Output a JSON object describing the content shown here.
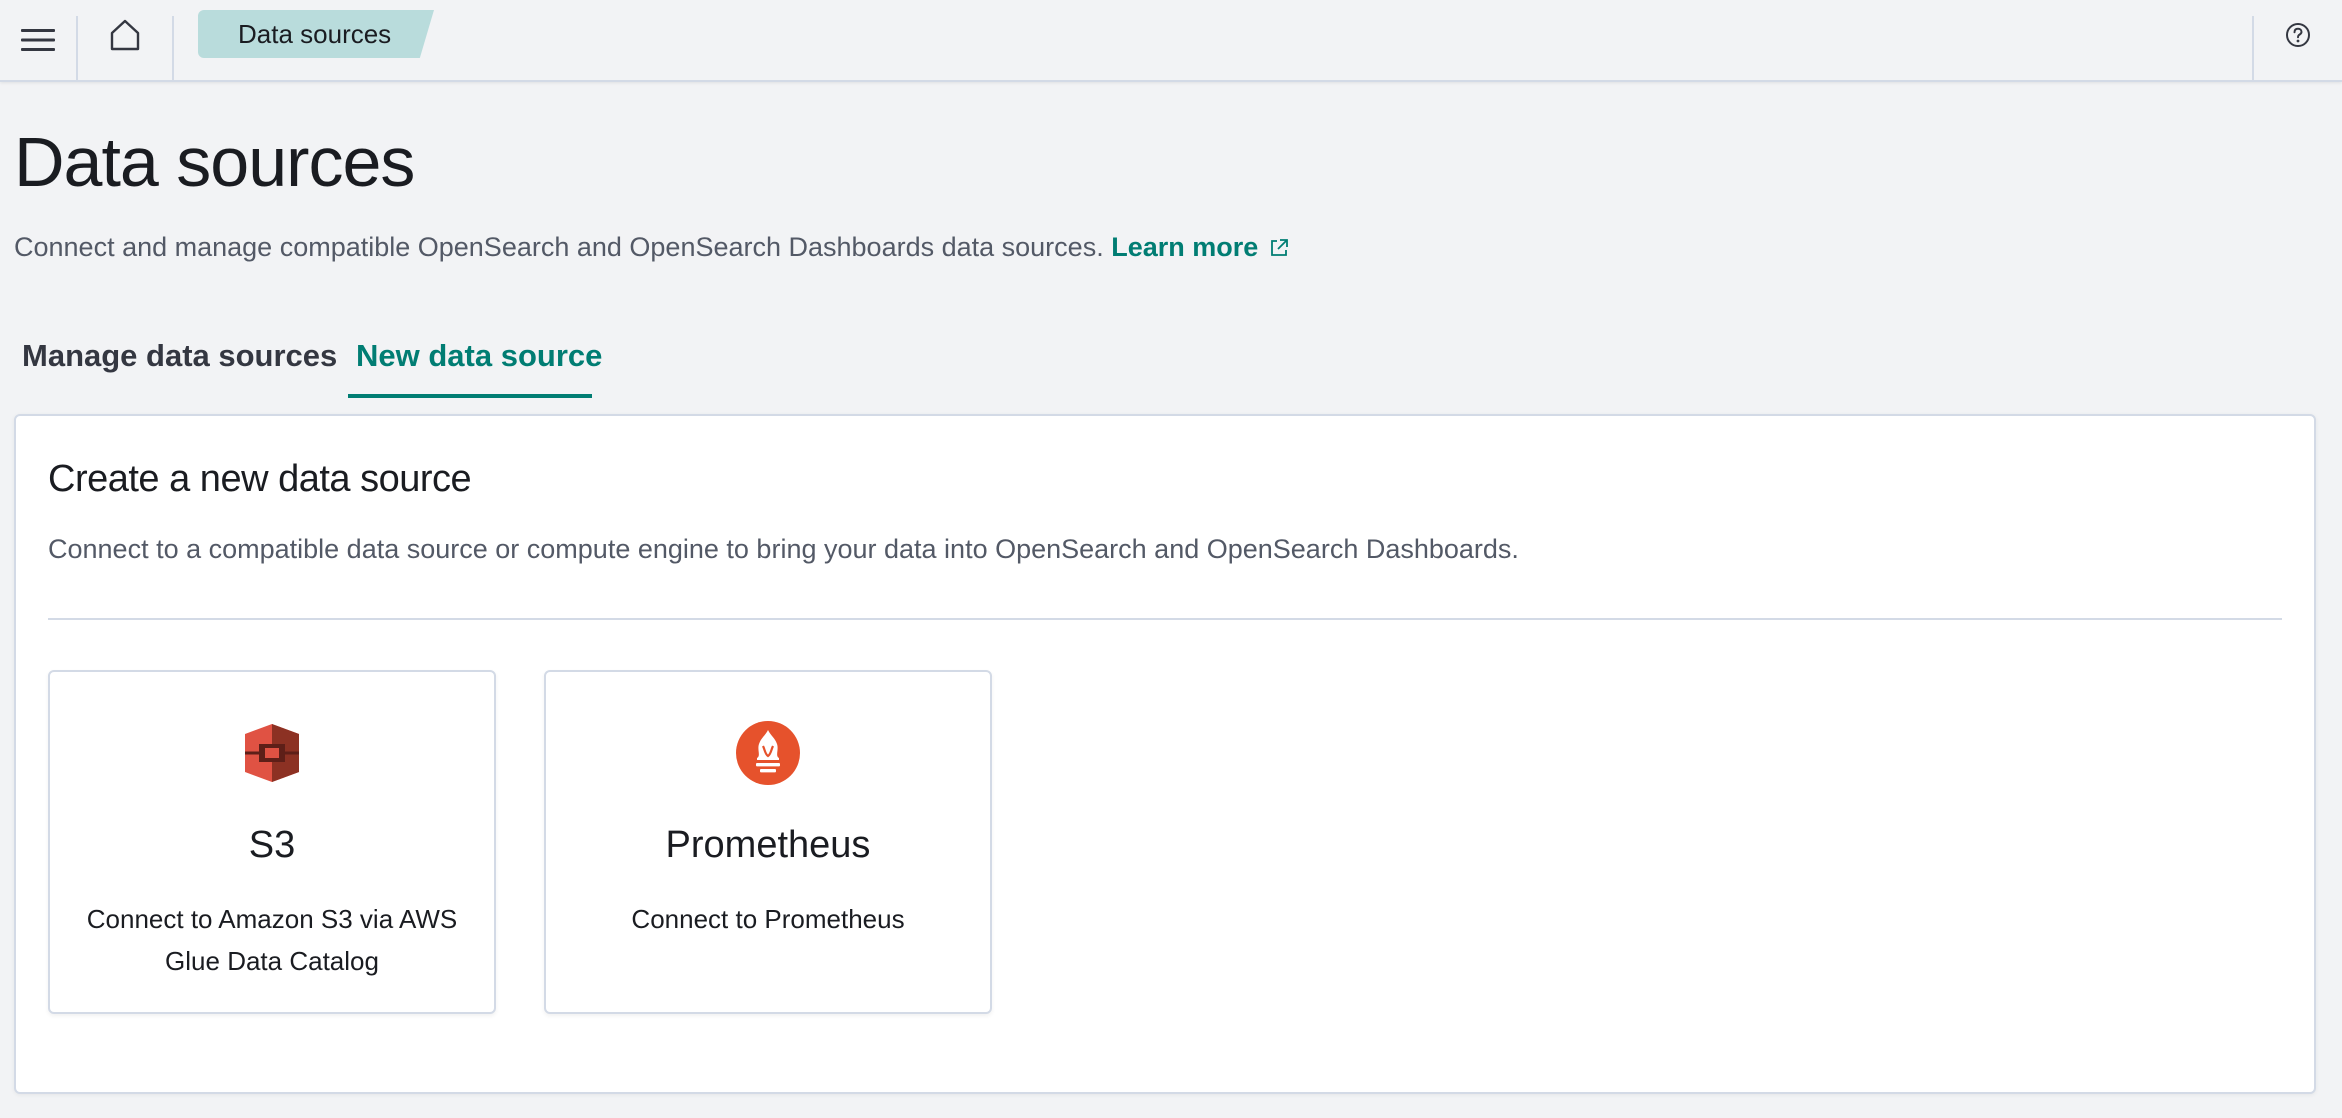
{
  "header": {
    "menu_icon": "hamburger-menu-icon",
    "home_icon": "home-icon",
    "help_icon": "help-icon",
    "breadcrumb": "Data sources"
  },
  "page": {
    "title": "Data sources",
    "description": "Connect and manage compatible OpenSearch and OpenSearch Dashboards data sources.",
    "learn_more": "Learn more"
  },
  "tabs": [
    {
      "label": "Manage data sources",
      "selected": false
    },
    {
      "label": "New data source",
      "selected": true
    }
  ],
  "panel": {
    "title": "Create a new data source",
    "description": "Connect to a compatible data source or compute engine to bring your data into OpenSearch and OpenSearch Dashboards."
  },
  "cards": [
    {
      "title": "S3",
      "description": "Connect to Amazon S3 via AWS Glue Data Catalog",
      "icon": "s3-icon"
    },
    {
      "title": "Prometheus",
      "description": "Connect to Prometheus",
      "icon": "prometheus-icon"
    }
  ],
  "colors": {
    "accent": "#017d73",
    "breadcrumb_bg": "#b9dcdc",
    "s3_red": "#e05243",
    "prometheus_orange": "#e6522c"
  }
}
